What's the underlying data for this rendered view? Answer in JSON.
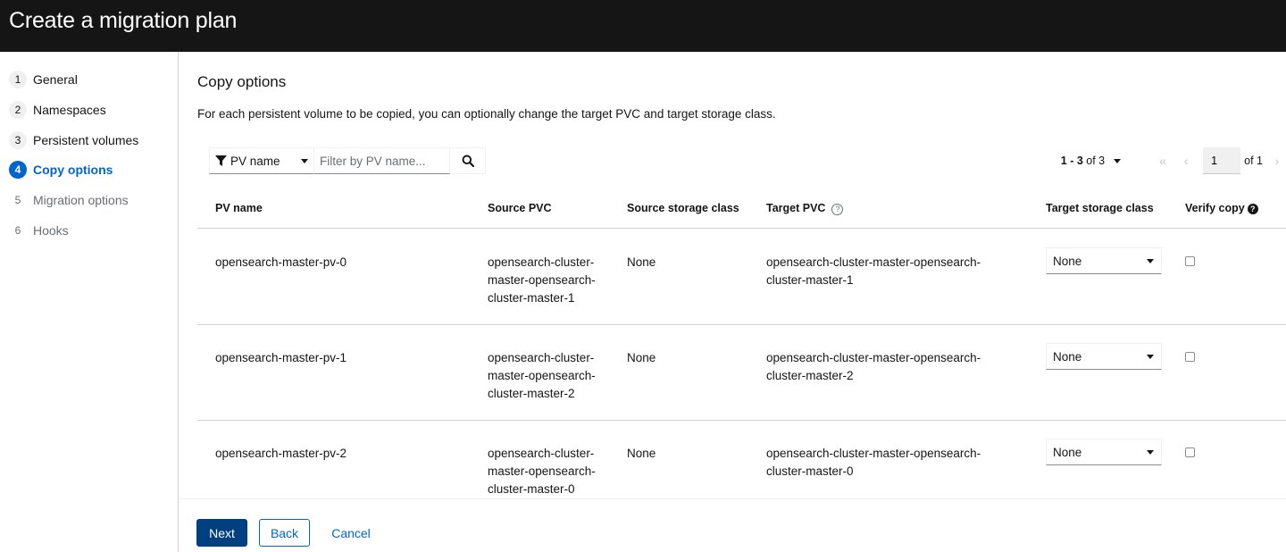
{
  "header": {
    "title": "Create a migration plan"
  },
  "steps": [
    {
      "num": "1",
      "label": "General"
    },
    {
      "num": "2",
      "label": "Namespaces"
    },
    {
      "num": "3",
      "label": "Persistent volumes"
    },
    {
      "num": "4",
      "label": "Copy options"
    },
    {
      "num": "5",
      "label": "Migration options"
    },
    {
      "num": "6",
      "label": "Hooks"
    }
  ],
  "main": {
    "title": "Copy options",
    "description": "For each persistent volume to be copied, you can optionally change the target PVC and target storage class."
  },
  "toolbar": {
    "filter_select": "PV name",
    "filter_placeholder": "Filter by PV name...",
    "filter_value": ""
  },
  "pagination": {
    "range": "1 - 3",
    "of_total": "of 3",
    "page": "1",
    "of_pages": "of 1",
    "first_icon": "«",
    "prev_icon": "‹",
    "next_icon": "›"
  },
  "table": {
    "headers": {
      "pv_name": "PV name",
      "source_pvc": "Source PVC",
      "source_storage_class": "Source storage class",
      "target_pvc": "Target PVC",
      "target_storage_class": "Target storage class",
      "verify_copy": "Verify copy"
    },
    "help_glyph": "?",
    "rows": [
      {
        "pv_name": "opensearch-master-pv-0",
        "source_pvc": [
          "opensearch-cluster-",
          "master-opensearch-",
          "cluster-master-1"
        ],
        "source_storage_class": "None",
        "target_pvc": [
          "opensearch-cluster-master-opensearch-",
          "cluster-master-1"
        ],
        "target_storage_class": "None",
        "verify_copy": false
      },
      {
        "pv_name": "opensearch-master-pv-1",
        "source_pvc": [
          "opensearch-cluster-",
          "master-opensearch-",
          "cluster-master-2"
        ],
        "source_storage_class": "None",
        "target_pvc": [
          "opensearch-cluster-master-opensearch-",
          "cluster-master-2"
        ],
        "target_storage_class": "None",
        "verify_copy": false
      },
      {
        "pv_name": "opensearch-master-pv-2",
        "source_pvc": [
          "opensearch-cluster-",
          "master-opensearch-",
          "cluster-master-0"
        ],
        "source_storage_class": "None",
        "target_pvc": [
          "opensearch-cluster-master-opensearch-",
          "cluster-master-0"
        ],
        "target_storage_class": "None",
        "verify_copy": false
      }
    ]
  },
  "footer": {
    "next": "Next",
    "back": "Back",
    "cancel": "Cancel"
  },
  "colors": {
    "primary": "#004080",
    "link": "#0066cc",
    "header_bg": "#151515"
  }
}
